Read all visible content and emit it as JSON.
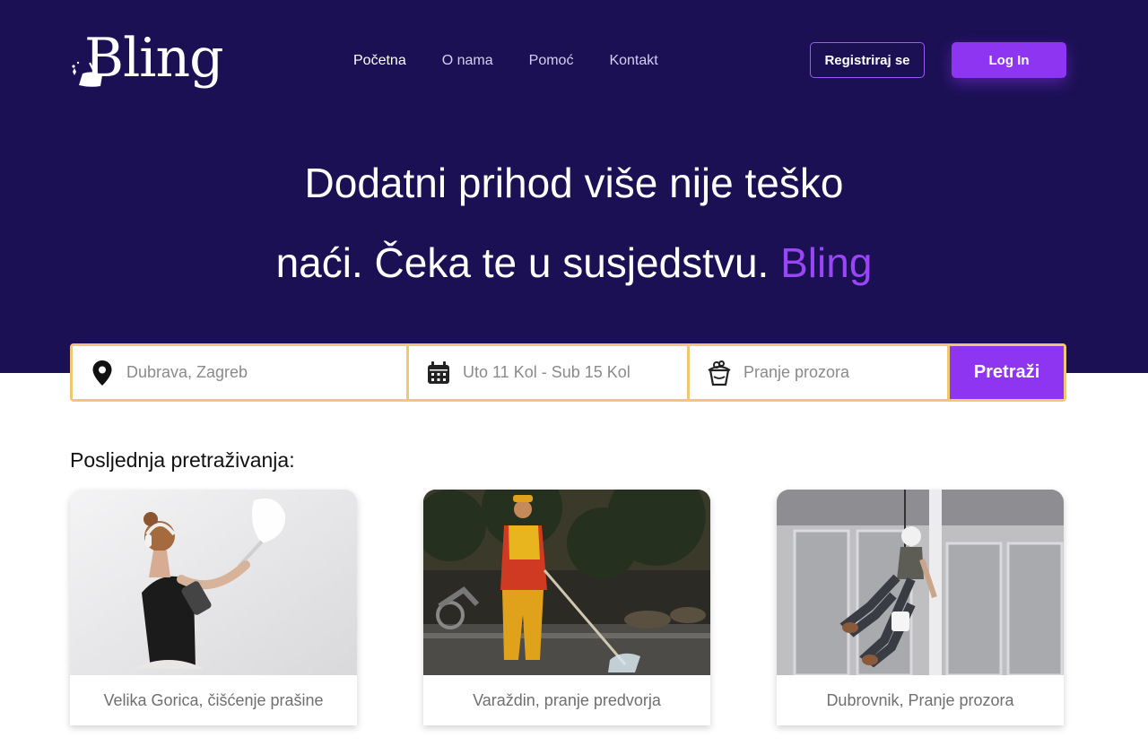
{
  "brand": {
    "name": "Bling",
    "accent": "#8e35f2",
    "hero_bg": "#1b1054",
    "search_border": "#f0c874"
  },
  "nav": {
    "items": [
      {
        "label": "Početna",
        "active": true
      },
      {
        "label": "O nama",
        "active": false
      },
      {
        "label": "Pomoć",
        "active": false
      },
      {
        "label": "Kontakt",
        "active": false
      }
    ]
  },
  "auth": {
    "register_label": "Registriraj se",
    "login_label": "Log In"
  },
  "hero": {
    "line1": "Dodatni prihod više nije teško",
    "line2": "naći. Čeka te u susjedstvu.",
    "accent_word": "Bling"
  },
  "search": {
    "location_placeholder": "Dubrava, Zagreb",
    "location_icon": "map-pin-icon",
    "date_placeholder": "Uto 11 Kol - Sub 15 Kol",
    "date_icon": "calendar-icon",
    "service_placeholder": "Pranje prozora",
    "service_icon": "bucket-icon",
    "button_label": "Pretraži"
  },
  "recent": {
    "title": "Posljednja pretraživanja:",
    "cards": [
      {
        "caption": "Velika Gorica, čišćenje prašine"
      },
      {
        "caption": "Varaždin, pranje predvorja"
      },
      {
        "caption": "Dubrovnik, Pranje prozora"
      }
    ]
  }
}
